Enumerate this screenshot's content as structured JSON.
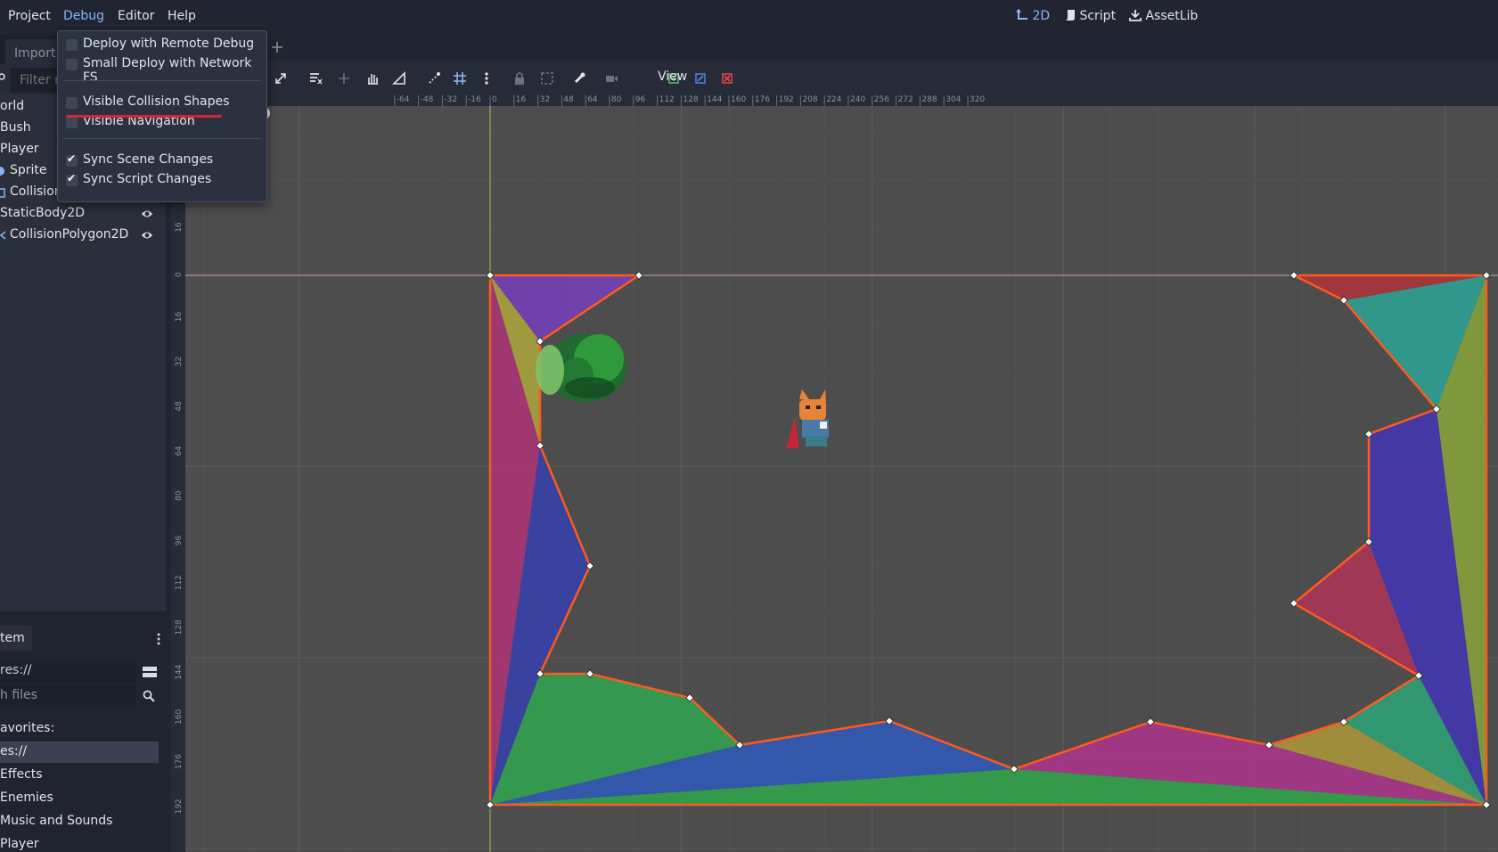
{
  "menubar": {
    "items": [
      "Project",
      "Debug",
      "Editor",
      "Help"
    ],
    "workspaces": [
      "2D",
      "Script",
      "AssetLib"
    ]
  },
  "scene_dock": {
    "import_tab": "Import",
    "filter_placeholder": "Filter n",
    "tree": [
      {
        "label": "orld",
        "eye": false
      },
      {
        "label": "Bush",
        "eye": false
      },
      {
        "label": "Player",
        "eye": false
      },
      {
        "label": "Sprite",
        "eye": false
      },
      {
        "label": "CollisionShape2D",
        "eye": true
      },
      {
        "label": "StaticBody2D",
        "eye": true
      },
      {
        "label": "CollisionPolygon2D",
        "eye": true
      }
    ]
  },
  "filesystem_dock": {
    "tab_label": "tem",
    "path": "res://",
    "search_placeholder": "h files",
    "rows": [
      {
        "label": "avorites:",
        "selected": false
      },
      {
        "label": "es://",
        "selected": true
      },
      {
        "label": "Effects",
        "selected": false
      },
      {
        "label": "Enemies",
        "selected": false
      },
      {
        "label": "Music and Sounds",
        "selected": false
      },
      {
        "label": "Player",
        "selected": false
      }
    ]
  },
  "toolbar": {
    "view_label": "View"
  },
  "debug_menu": {
    "items": [
      {
        "label": "Deploy with Remote Debug",
        "checked": false
      },
      {
        "label": "Small Deploy with Network FS",
        "checked": false
      },
      {
        "label": "Visible Collision Shapes",
        "checked": false
      },
      {
        "label": "Visible Navigation",
        "checked": false
      },
      {
        "label": "Sync Scene Changes",
        "checked": true
      },
      {
        "label": "Sync Script Changes",
        "checked": true
      }
    ]
  },
  "ruler": {
    "h_ticks": [
      "-64",
      "-48",
      "-32",
      "-16",
      "0",
      "16",
      "32",
      "48",
      "64",
      "80",
      "96",
      "112",
      "128",
      "144",
      "160",
      "176",
      "192",
      "208",
      "224",
      "240",
      "256",
      "272",
      "288",
      "304",
      "320"
    ],
    "v_ticks": [
      "16",
      "0",
      "16",
      "32",
      "48",
      "64",
      "80",
      "96",
      "112",
      "128",
      "144",
      "160",
      "176",
      "192"
    ]
  },
  "colors": {
    "accent": "#8ab4f8",
    "polygon_outline": "#ff5a1f",
    "highlight_underline": "#d4262c"
  }
}
